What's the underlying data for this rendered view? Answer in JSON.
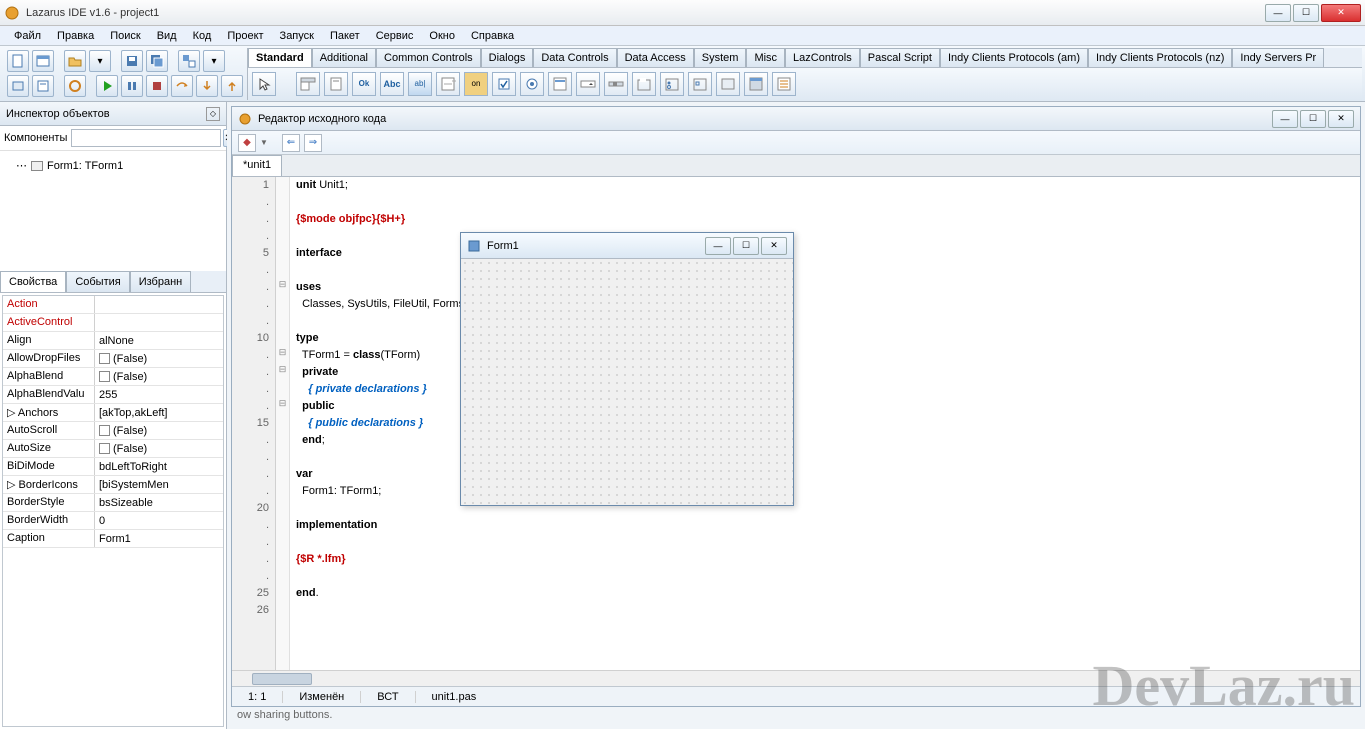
{
  "window": {
    "title": "Lazarus IDE v1.6 - project1"
  },
  "menu": [
    "Файл",
    "Правка",
    "Поиск",
    "Вид",
    "Код",
    "Проект",
    "Запуск",
    "Пакет",
    "Сервис",
    "Окно",
    "Справка"
  ],
  "componentTabs": [
    "Standard",
    "Additional",
    "Common Controls",
    "Dialogs",
    "Data Controls",
    "Data Access",
    "System",
    "Misc",
    "LazControls",
    "Pascal Script",
    "Indy Clients Protocols (am)",
    "Indy Clients Protocols (nz)",
    "Indy Servers Pr"
  ],
  "objectInspector": {
    "title": "Инспектор объектов",
    "componentsLabel": "Компоненты",
    "treeItem": "Form1: TForm1",
    "tabs": [
      "Свойства",
      "События",
      "Избранн"
    ],
    "props": [
      {
        "n": "Action",
        "v": "",
        "red": true
      },
      {
        "n": "ActiveControl",
        "v": "",
        "red": true
      },
      {
        "n": "Align",
        "v": "alNone"
      },
      {
        "n": "AllowDropFiles",
        "v": "(False)",
        "chk": true
      },
      {
        "n": "AlphaBlend",
        "v": "(False)",
        "chk": true
      },
      {
        "n": "AlphaBlendValu",
        "v": "255"
      },
      {
        "n": "Anchors",
        "v": "[akTop,akLeft]",
        "exp": true
      },
      {
        "n": "AutoScroll",
        "v": "(False)",
        "chk": true
      },
      {
        "n": "AutoSize",
        "v": "(False)",
        "chk": true
      },
      {
        "n": "BiDiMode",
        "v": "bdLeftToRight"
      },
      {
        "n": "BorderIcons",
        "v": "[biSystemMen",
        "exp": true
      },
      {
        "n": "BorderStyle",
        "v": "bsSizeable"
      },
      {
        "n": "BorderWidth",
        "v": "0"
      },
      {
        "n": "Caption",
        "v": "Form1"
      }
    ]
  },
  "editor": {
    "title": "Редактор исходного кода",
    "fileTab": "*unit1",
    "lines": [
      {
        "num": "1",
        "fold": "",
        "html": "<span class='kw'>unit</span> Unit1;"
      },
      {
        "num": ".",
        "fold": "",
        "html": ""
      },
      {
        "num": ".",
        "fold": "",
        "html": "<span class='dir'>{$mode objfpc}{$H+}</span>"
      },
      {
        "num": ".",
        "fold": "",
        "html": ""
      },
      {
        "num": "5",
        "fold": "",
        "html": "<span class='kw'>interface</span>"
      },
      {
        "num": ".",
        "fold": "",
        "html": ""
      },
      {
        "num": ".",
        "fold": "⊟",
        "html": "<span class='kw'>uses</span>"
      },
      {
        "num": ".",
        "fold": "",
        "html": "  Classes, SysUtils, FileUtil, Forms, Controls, Graphics, Dialogs;"
      },
      {
        "num": ".",
        "fold": "",
        "html": ""
      },
      {
        "num": "10",
        "fold": "",
        "html": "<span class='kw'>type</span>"
      },
      {
        "num": ".",
        "fold": "⊟",
        "html": "  TForm1 = <span class='kw'>class</span>(TForm)"
      },
      {
        "num": ".",
        "fold": "⊟",
        "html": "  <span class='kw'>private</span>"
      },
      {
        "num": ".",
        "fold": "",
        "html": "    <span class='cm'>{ private declarations }</span>"
      },
      {
        "num": ".",
        "fold": "⊟",
        "html": "  <span class='kw'>public</span>"
      },
      {
        "num": "15",
        "fold": "",
        "html": "    <span class='cm'>{ public declarations }</span>"
      },
      {
        "num": ".",
        "fold": "",
        "html": "  <span class='kw'>end</span>;"
      },
      {
        "num": ".",
        "fold": "",
        "html": ""
      },
      {
        "num": ".",
        "fold": "",
        "html": "<span class='kw'>var</span>"
      },
      {
        "num": ".",
        "fold": "",
        "html": "  Form1: TForm1;"
      },
      {
        "num": "20",
        "fold": "",
        "html": ""
      },
      {
        "num": ".",
        "fold": "",
        "html": "<span class='kw'>implementation</span>"
      },
      {
        "num": ".",
        "fold": "",
        "html": ""
      },
      {
        "num": ".",
        "fold": "",
        "html": "<span class='dir'>{$R *.lfm}</span>"
      },
      {
        "num": ".",
        "fold": "",
        "html": ""
      },
      {
        "num": "25",
        "fold": "",
        "html": "<span class='kw'>end</span>."
      },
      {
        "num": "26",
        "fold": "",
        "html": ""
      }
    ],
    "status": {
      "pos": "1: 1",
      "state": "Изменён",
      "ins": "ВСТ",
      "file": "unit1.pas"
    }
  },
  "form": {
    "title": "Form1"
  },
  "watermark": "DevLaz.ru",
  "bottomHint": "ow sharing buttons."
}
